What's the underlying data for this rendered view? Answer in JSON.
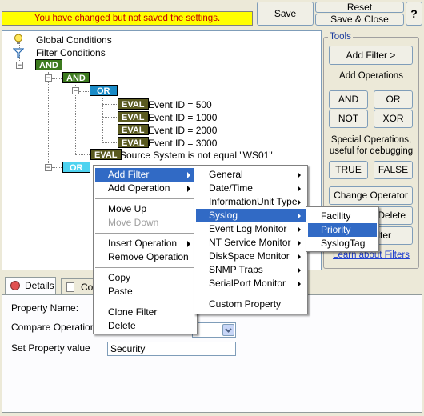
{
  "banner": "You have changed but not saved the settings.",
  "toolbar": {
    "save": "Save",
    "reset": "Reset",
    "save_close": "Save & Close",
    "help": "?"
  },
  "tree": {
    "global": "Global Conditions",
    "filter": "Filter Conditions",
    "and1": "AND",
    "and2": "AND",
    "or1": "OR",
    "or2": "OR",
    "eval_tag": "EVAL",
    "evals": [
      "Event ID = 500",
      "Event ID = 1000",
      "Event ID = 2000",
      "Event ID = 3000"
    ],
    "source": "Source System is not equal \"WS01\""
  },
  "tools": {
    "title": "Tools",
    "add_filter": "Add Filter >",
    "add_ops": "Add Operations",
    "and": "AND",
    "or": "OR",
    "not": "NOT",
    "xor": "XOR",
    "special": "Special Operations, useful for debugging",
    "true": "TRUE",
    "false": "FALSE",
    "change_op": "Change Operator",
    "delete": "Delete",
    "filter": "lter",
    "learn": "Learn about Filters"
  },
  "tabs": {
    "details": "Details",
    "conditions": "Co"
  },
  "props": {
    "name_label": "Property Name:",
    "compare_label": "Compare Operation:",
    "value_label": "Set Property value",
    "value": "Security"
  },
  "menu1": [
    "Add Filter",
    "Add Operation",
    "Move Up",
    "Move Down",
    "Insert Operation",
    "Remove Operation",
    "Copy",
    "Paste",
    "Clone Filter",
    "Delete"
  ],
  "menu2": [
    "General",
    "Date/Time",
    "InformationUnit Type",
    "Syslog",
    "Event Log Monitor",
    "NT Service Monitor",
    "DiskSpace Monitor",
    "SNMP Traps",
    "SerialPort Monitor",
    "Custom Property"
  ],
  "menu3": [
    "Facility",
    "Priority",
    "SyslogTag"
  ]
}
